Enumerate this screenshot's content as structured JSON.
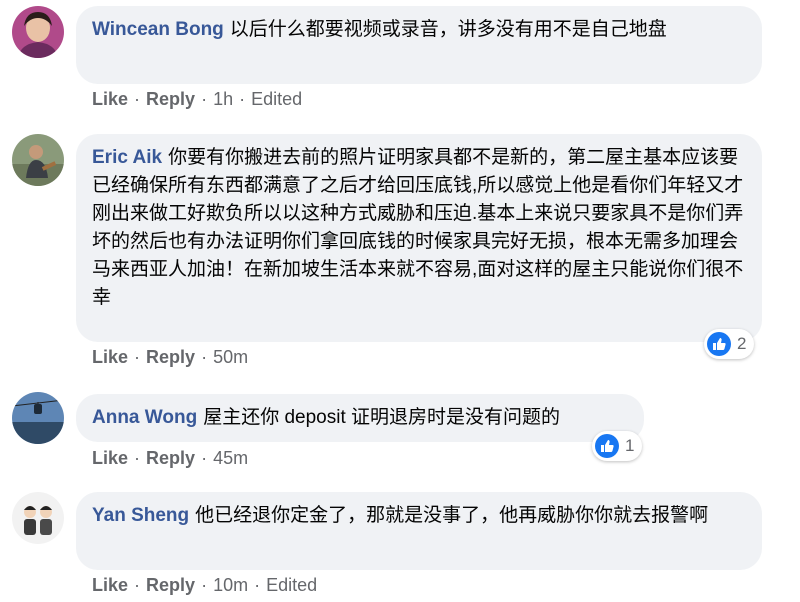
{
  "comments": [
    {
      "author": "Wincean Bong",
      "text": "以后什么都要视频或录音，讲多没有用不是自己地盘",
      "like_label": "Like",
      "reply_label": "Reply",
      "time": "1h",
      "edited": "Edited"
    },
    {
      "author": "Eric Aik",
      "text": "你要有你搬进去前的照片证明家具都不是新的，第二屋主基本应该要已经确保所有东西都满意了之后才给回压底钱,所以感觉上他是看你们年轻又才刚出来做工好欺负所以以这种方式威胁和压迫.基本上来说只要家具不是你们弄坏的然后也有办法证明你们拿回底钱的时候家具完好无损，根本无需多加理会\n马来西亚人加油！在新加坡生活本来就不容易,面对这样的屋主只能说你们很不幸",
      "like_label": "Like",
      "reply_label": "Reply",
      "time": "50m",
      "reaction_count": "2"
    },
    {
      "author": "Anna Wong",
      "text": "屋主还你 deposit 证明退房时是没有问题的",
      "like_label": "Like",
      "reply_label": "Reply",
      "time": "45m",
      "reaction_count": "1"
    },
    {
      "author": "Yan Sheng",
      "text": "他已经退你定金了，那就是没事了，他再威胁你你就去报警啊",
      "like_label": "Like",
      "reply_label": "Reply",
      "time": "10m",
      "edited": "Edited"
    }
  ],
  "separator": "·",
  "colors": {
    "author": "#385898",
    "bubble": "#f0f2f5",
    "meta": "#65676b",
    "like_blue": "#1877f2"
  }
}
